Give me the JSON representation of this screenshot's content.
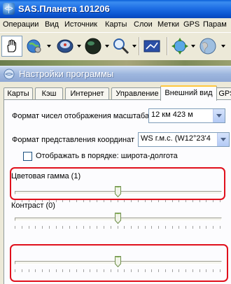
{
  "window": {
    "title": "SAS.Планета 101206"
  },
  "menu": {
    "items": [
      "Операции",
      "Вид",
      "Источник",
      "Карты",
      "Слои",
      "Метки",
      "GPS",
      "Парам"
    ]
  },
  "dialog": {
    "title": "Настройки программы",
    "tabs": [
      "Карты",
      "Кэш",
      "Интернет",
      "Управление",
      "Внешний вид",
      "GPS"
    ],
    "active_tab": "Внешний вид",
    "scale_format_label": "Формат чисел отображения масштаба",
    "scale_format_value": "12 км 423 м",
    "coord_format_label": "Формат представления координат",
    "coord_format_value": "WS г.м.с. (W12°23'4",
    "latlon_order_label": "Отображать в порядке: широта-долгота",
    "latlon_order_checked": false,
    "color_scheme_label": "Цветовая гамма (1)",
    "contrast_label": "Контраст (0)"
  },
  "sliders": [
    {
      "name": "color-scheme",
      "position": 0.5
    },
    {
      "name": "contrast",
      "position": 0.5
    },
    {
      "name": "unlabeled",
      "position": 0.5
    }
  ],
  "colors": {
    "highlight": "#e0101c",
    "active_tab_accent": "#ffc73c",
    "title_bar": "#0b55d0"
  }
}
